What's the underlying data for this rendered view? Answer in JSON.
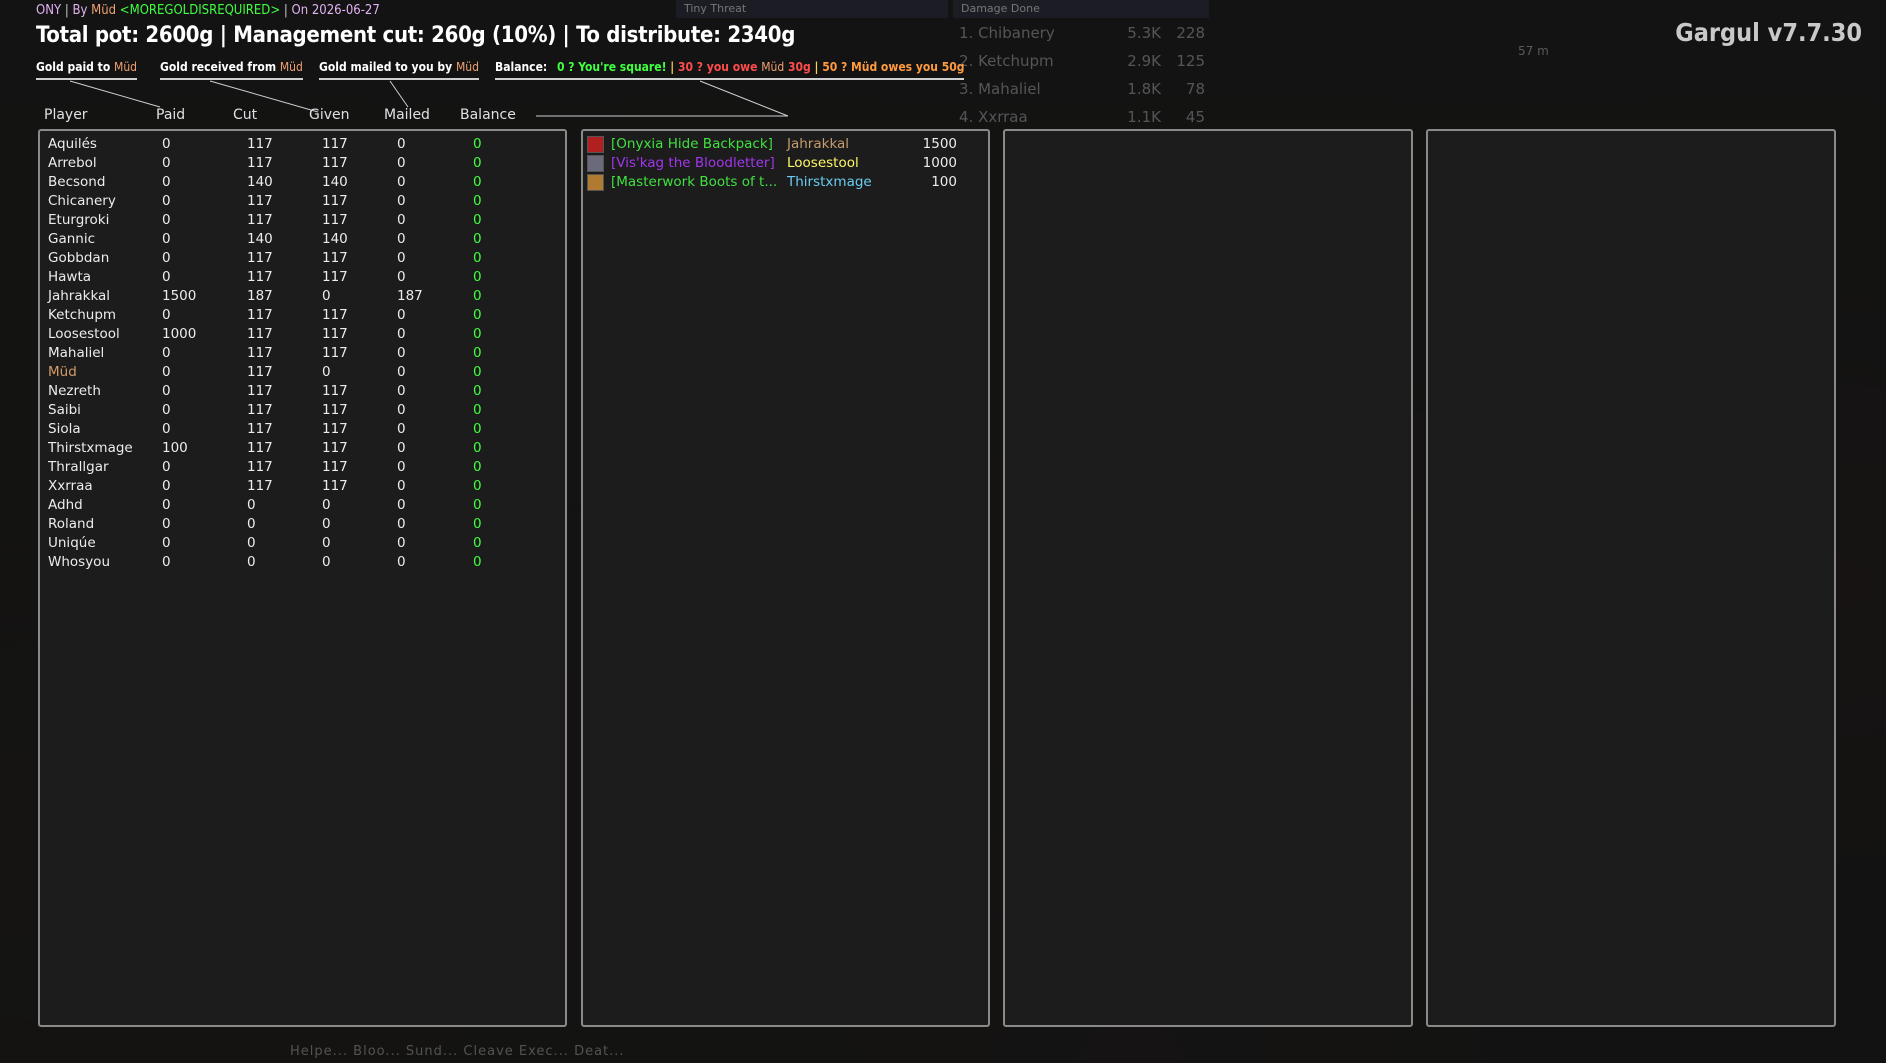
{
  "addon_title": "Gargul v7.7.30",
  "header": {
    "raid": "ONY",
    "by_label": "By",
    "leader": "Müd",
    "guild": "<MOREGOLDISREQUIRED>",
    "on_label": "On",
    "date": "2026-06-27"
  },
  "totals_text": "Total pot: 2600g | Management cut: 260g (10%) | To distribute: 2340g",
  "legend": {
    "paid_prefix": "Gold paid to",
    "received_prefix": "Gold received from",
    "mailed_prefix": "Gold mailed to you by",
    "name": "Müd",
    "balance_label": "Balance:",
    "square": "0 ? You're square!",
    "owe_prefix": "30 ? you owe",
    "owe_amount": "30g",
    "owes_text": "50 ? Müd owes you 50g",
    "pipe": "|"
  },
  "columns": [
    "Player",
    "Paid",
    "Cut",
    "Given",
    "Mailed",
    "Balance"
  ],
  "players": [
    {
      "name": "Aquilés",
      "paid": "0",
      "cut": "117",
      "given": "117",
      "mailed": "0",
      "balance": "0"
    },
    {
      "name": "Arrebol",
      "paid": "0",
      "cut": "117",
      "given": "117",
      "mailed": "0",
      "balance": "0"
    },
    {
      "name": "Becsond",
      "paid": "0",
      "cut": "140",
      "given": "140",
      "mailed": "0",
      "balance": "0"
    },
    {
      "name": "Chicanery",
      "paid": "0",
      "cut": "117",
      "given": "117",
      "mailed": "0",
      "balance": "0"
    },
    {
      "name": "Eturgroki",
      "paid": "0",
      "cut": "117",
      "given": "117",
      "mailed": "0",
      "balance": "0"
    },
    {
      "name": "Gannic",
      "paid": "0",
      "cut": "140",
      "given": "140",
      "mailed": "0",
      "balance": "0"
    },
    {
      "name": "Gobbdan",
      "paid": "0",
      "cut": "117",
      "given": "117",
      "mailed": "0",
      "balance": "0"
    },
    {
      "name": "Hawta",
      "paid": "0",
      "cut": "117",
      "given": "117",
      "mailed": "0",
      "balance": "0"
    },
    {
      "name": "Jahrakkal",
      "paid": "1500",
      "cut": "187",
      "given": "0",
      "mailed": "187",
      "balance": "0"
    },
    {
      "name": "Ketchupm",
      "paid": "0",
      "cut": "117",
      "given": "117",
      "mailed": "0",
      "balance": "0"
    },
    {
      "name": "Loosestool",
      "paid": "1000",
      "cut": "117",
      "given": "117",
      "mailed": "0",
      "balance": "0"
    },
    {
      "name": "Mahaliel",
      "paid": "0",
      "cut": "117",
      "given": "117",
      "mailed": "0",
      "balance": "0"
    },
    {
      "name": "Müd",
      "paid": "0",
      "cut": "117",
      "given": "0",
      "mailed": "0",
      "balance": "0",
      "color": "#d49a6a"
    },
    {
      "name": "Nezreth",
      "paid": "0",
      "cut": "117",
      "given": "117",
      "mailed": "0",
      "balance": "0"
    },
    {
      "name": "Saibi",
      "paid": "0",
      "cut": "117",
      "given": "117",
      "mailed": "0",
      "balance": "0"
    },
    {
      "name": "Siola",
      "paid": "0",
      "cut": "117",
      "given": "117",
      "mailed": "0",
      "balance": "0"
    },
    {
      "name": "Thirstxmage",
      "paid": "100",
      "cut": "117",
      "given": "117",
      "mailed": "0",
      "balance": "0"
    },
    {
      "name": "Thrallgar",
      "paid": "0",
      "cut": "117",
      "given": "117",
      "mailed": "0",
      "balance": "0"
    },
    {
      "name": "Xxrraa",
      "paid": "0",
      "cut": "117",
      "given": "117",
      "mailed": "0",
      "balance": "0"
    },
    {
      "name": "Adhd",
      "paid": "0",
      "cut": "0",
      "given": "0",
      "mailed": "0",
      "balance": "0"
    },
    {
      "name": "Roland",
      "paid": "0",
      "cut": "0",
      "given": "0",
      "mailed": "0",
      "balance": "0"
    },
    {
      "name": "Uniqúe",
      "paid": "0",
      "cut": "0",
      "given": "0",
      "mailed": "0",
      "balance": "0"
    },
    {
      "name": "Whosyou",
      "paid": "0",
      "cut": "0",
      "given": "0",
      "mailed": "0",
      "balance": "0"
    }
  ],
  "loot": [
    {
      "item": "[Onyxia Hide Backpack]",
      "item_color": "#40e040",
      "winner": "Jahrakkal",
      "winner_color": "#c69b6d",
      "price": "1500",
      "icon": "backpack-icon",
      "icon_color": "#b02020"
    },
    {
      "item": "[Vis'kag the Bloodletter]",
      "item_color": "#a335ee",
      "winner": "Loosestool",
      "winner_color": "#fff569",
      "price": "1000",
      "icon": "sword-icon",
      "icon_color": "#6a6a7a"
    },
    {
      "item": "[Masterwork Boots of t...",
      "item_color": "#40e040",
      "winner": "Thirstxmage",
      "winner_color": "#69ccf0",
      "price": "100",
      "icon": "boots-icon",
      "icon_color": "#b07a30"
    }
  ],
  "background": {
    "threat_title": "Tiny Threat",
    "damage_title": "Damage Done",
    "damage_rows": [
      {
        "label": "1. Chibanery",
        "v1": "5.3K",
        "v2": "228"
      },
      {
        "label": "2. Ketchupm",
        "v1": "2.9K",
        "v2": "125"
      },
      {
        "label": "3. Mahaliel",
        "v1": "1.8K",
        "v2": "78"
      },
      {
        "label": "4. Xxrraa",
        "v1": "1.1K",
        "v2": "45"
      }
    ],
    "distance": "57 m",
    "actions": "Helpe...  Bloo...  Sund...  Cleave  Exec...  Deat..."
  }
}
